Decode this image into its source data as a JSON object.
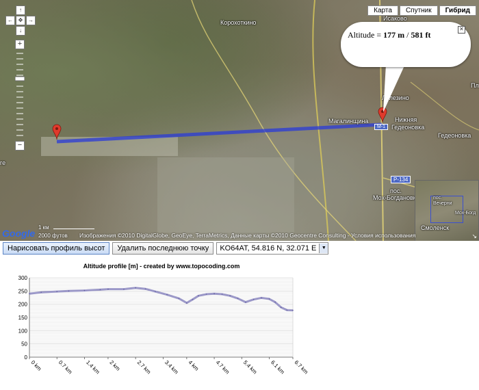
{
  "map": {
    "types": [
      "Карта",
      "Спутник",
      "Гибрид"
    ],
    "active_type": "Гибрид",
    "labels": {
      "isakovo": "Исаково",
      "korokhotkino": "Корохоткино",
      "magalinshchina": "Магалинщина",
      "nizhnyaya": "Нижняя",
      "gedeonovka1": "Гедеоновка",
      "gedeonovka2": "Гедеоновка",
      "lelezino": "Лелезино",
      "mokh1": "пос.",
      "mokh2": "Мох-Богдановка",
      "road_m1": "M-1",
      "road_p134": "P-134",
      "edge_ge": "ге",
      "edge_pl": "Пл"
    },
    "info_bubble": {
      "label": "Altitude = ",
      "meters": "177 m",
      "sep": " / ",
      "feet": "581 ft"
    },
    "minimap": {
      "label1": "пос.",
      "label2": "Вечерни",
      "label3": "Мох-Богд",
      "label4": "Смоленск"
    },
    "scale": {
      "ft": "2000 футов",
      "km": "1 км"
    },
    "copyright": "Изображения ©2010 DigitalGlobe, GeoEye, TerraMetrics, Данные карты ©2010 Geocentre Consulting - Условия использования",
    "logo": "Google"
  },
  "controls": {
    "draw_button": "Нарисовать профиль высот",
    "delete_button": "Удалить последнюю точку",
    "locator_value": "KO64AT, 54.816 N, 32.071 E"
  },
  "chart_data": {
    "type": "line",
    "title": "Altitude profile [m] - created by www.topocoding.com",
    "xlabel": "",
    "ylabel": "",
    "ylim": [
      0,
      300
    ],
    "xlim": [
      0,
      6.7
    ],
    "y_ticks": [
      "0",
      "50",
      "100",
      "150",
      "200",
      "250",
      "300"
    ],
    "x_ticks": [
      "0 km",
      "0.7 km",
      "1.4 km",
      "2 km",
      "2.7 km",
      "3.4 km",
      "4 km",
      "4.7 km",
      "5.4 km",
      "6.1 km",
      "6.7 km"
    ],
    "x_tick_values": [
      0,
      0.7,
      1.4,
      2.0,
      2.7,
      3.4,
      4.0,
      4.7,
      5.4,
      6.1,
      6.7
    ],
    "grid": true,
    "colors": {
      "line": "#9b98c8"
    },
    "x": [
      0,
      0.3,
      0.7,
      1.0,
      1.4,
      1.8,
      2.0,
      2.4,
      2.7,
      2.95,
      3.2,
      3.5,
      3.8,
      4.0,
      4.15,
      4.3,
      4.5,
      4.7,
      4.9,
      5.1,
      5.3,
      5.5,
      5.7,
      5.9,
      6.1,
      6.25,
      6.4,
      6.55,
      6.7
    ],
    "y": [
      240,
      245,
      248,
      250,
      252,
      255,
      257,
      257,
      262,
      258,
      248,
      236,
      222,
      205,
      218,
      232,
      238,
      240,
      238,
      232,
      222,
      208,
      218,
      224,
      220,
      208,
      188,
      178,
      177
    ]
  }
}
